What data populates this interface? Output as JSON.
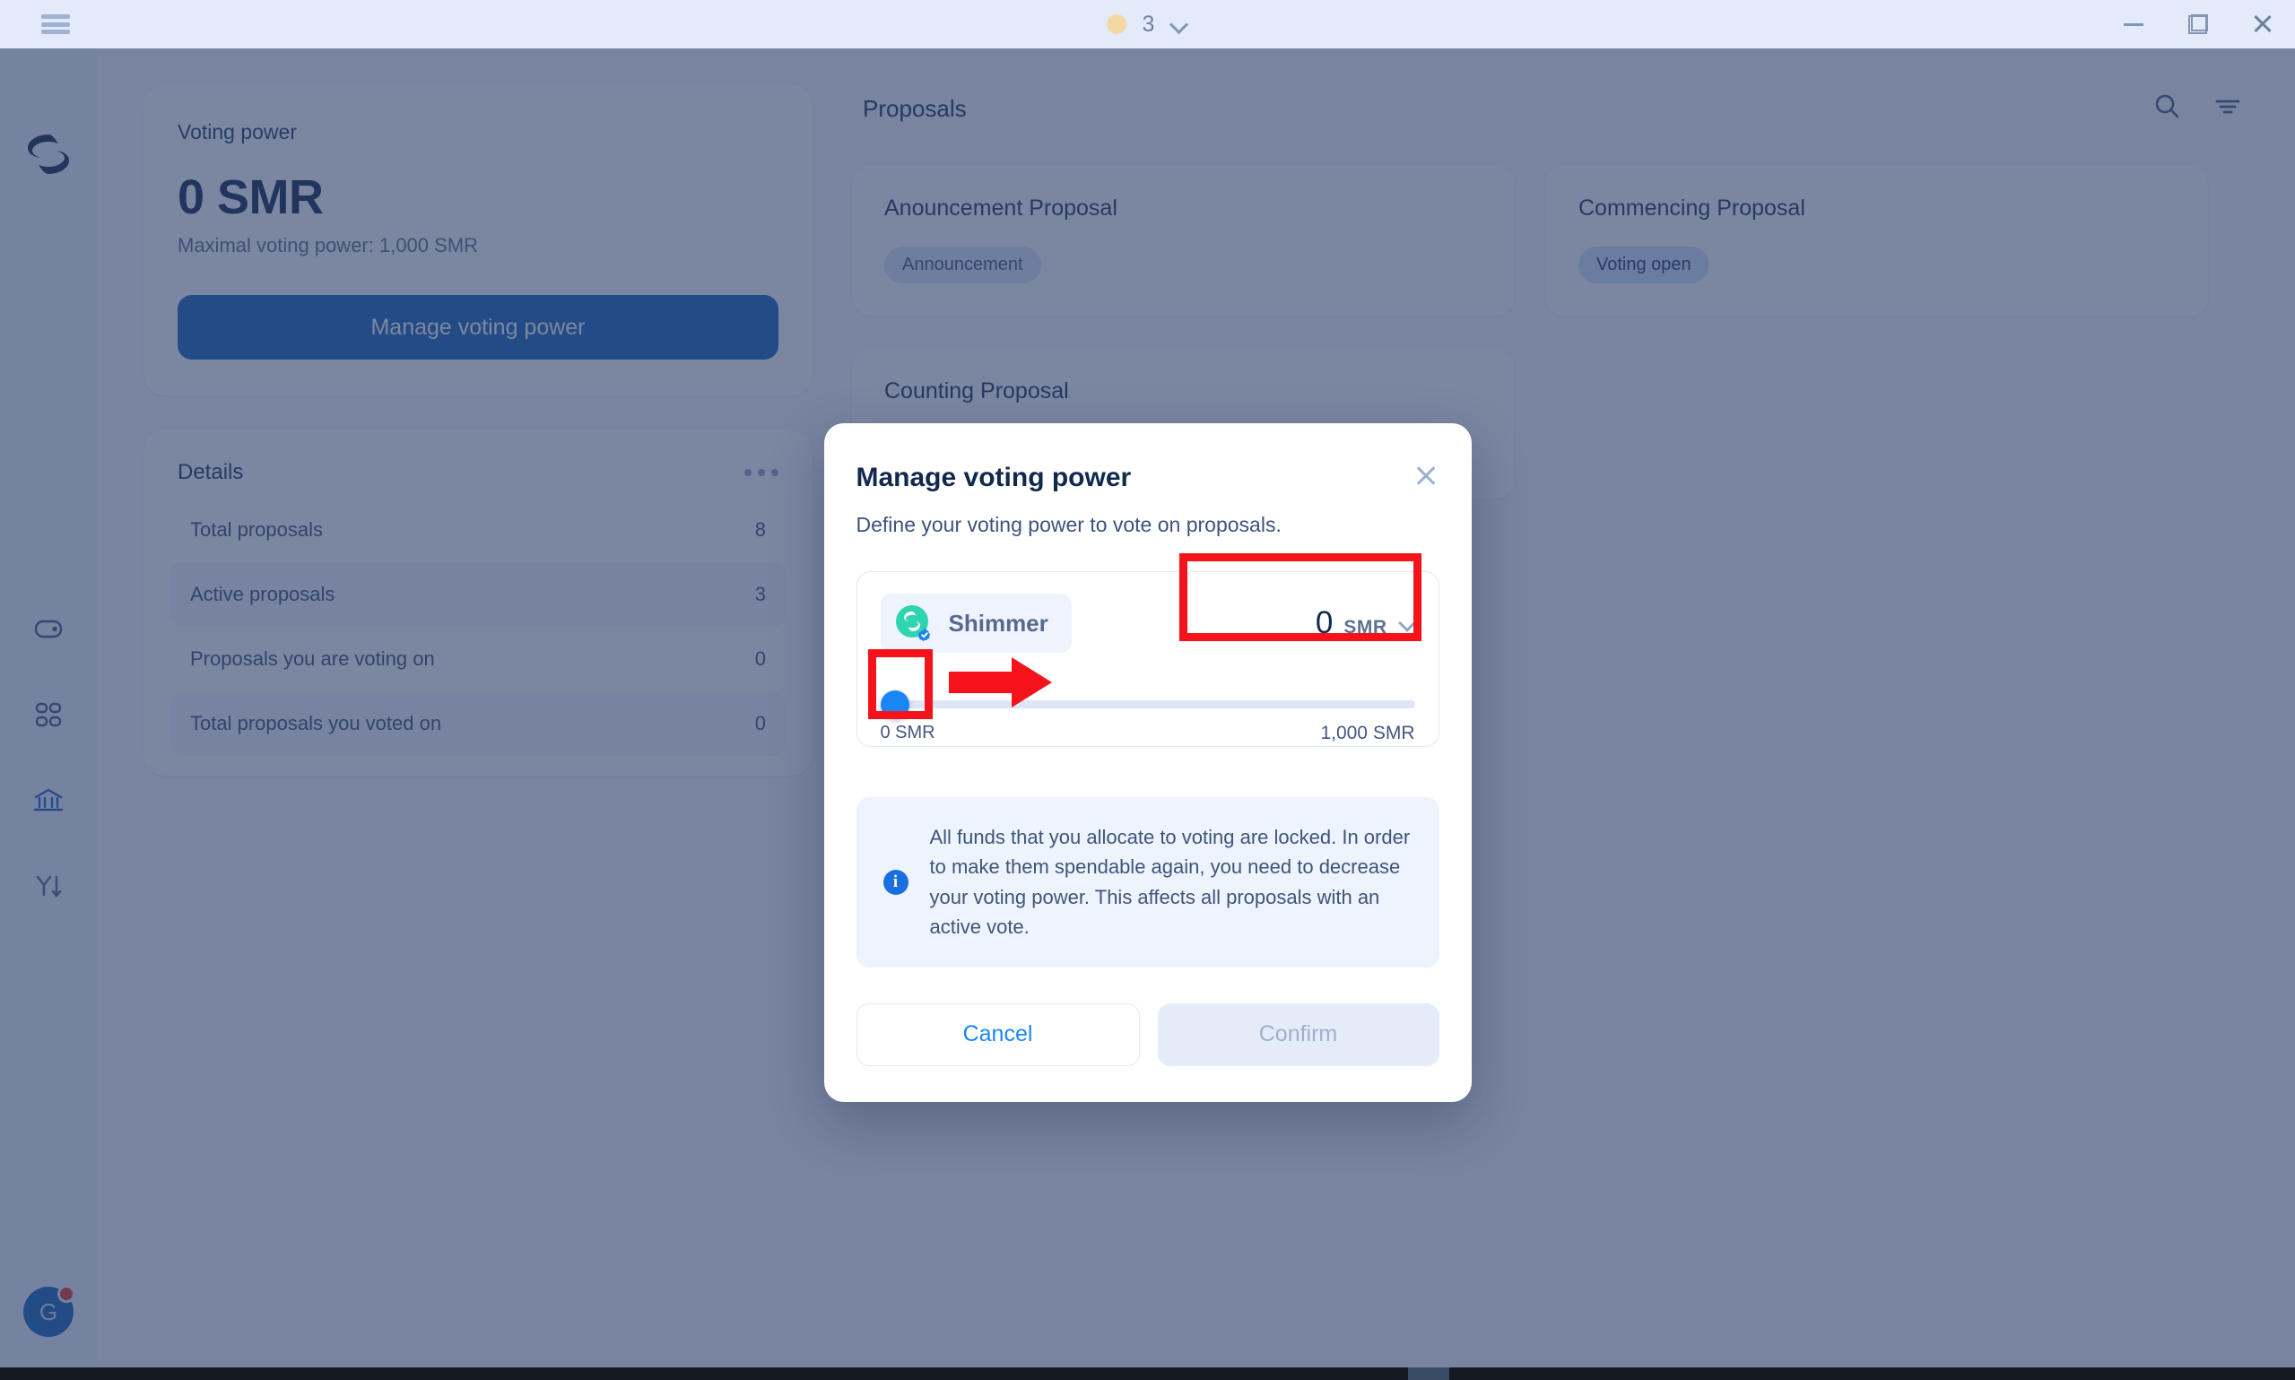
{
  "titlebar": {
    "menu_icon": "hamburger-icon",
    "network_count": "3",
    "network_dot_color": "#f2d9a4",
    "chevron_icon": "chevron-down-icon",
    "minimize_icon": "minimize-icon",
    "maximize_icon": "restore-window-icon",
    "close_icon": "close-icon"
  },
  "sidebar": {
    "logo": "shimmer-logo",
    "items": [
      {
        "name": "wallet",
        "icon": "wallet-icon",
        "active": false
      },
      {
        "name": "apps",
        "icon": "grid-apps-icon",
        "active": false
      },
      {
        "name": "governance",
        "icon": "bank-governance-icon",
        "active": true
      },
      {
        "name": "developer",
        "icon": "tools-icon",
        "active": false
      }
    ],
    "avatar_initial": "G",
    "avatar_color": "#1765b9",
    "notification_dot_color": "#e0392e"
  },
  "voting_power_card": {
    "label": "Voting power",
    "amount": "0 SMR",
    "maximal": "Maximal voting power: 1,000 SMR",
    "manage_button": "Manage voting power"
  },
  "details_card": {
    "title": "Details",
    "more_icon": "ellipsis-icon",
    "rows": [
      {
        "label": "Total proposals",
        "value": "8"
      },
      {
        "label": "Active proposals",
        "value": "3"
      },
      {
        "label": "Proposals you are voting on",
        "value": "0"
      },
      {
        "label": "Total proposals you voted on",
        "value": "0"
      }
    ]
  },
  "proposals": {
    "title": "Proposals",
    "search_icon": "search-icon",
    "filter_icon": "filter-icon",
    "cards": [
      {
        "name": "Anouncement Proposal",
        "status": "Announcement",
        "status_style": "pill-announcement"
      },
      {
        "name": "Commencing Proposal",
        "status": "Voting open",
        "status_style": "pill-voting"
      },
      {
        "name": "Counting Proposal",
        "status": "",
        "status_style": ""
      }
    ]
  },
  "modal": {
    "title": "Manage voting power",
    "close_icon": "close-icon",
    "subtitle": "Define your voting power to vote on proposals.",
    "token": {
      "name": "Shimmer",
      "logo_icon": "shimmer-token-icon",
      "verified_icon": "verified-badge-icon",
      "logo_color": "#2fd4b0",
      "verified_color": "#1a86f5"
    },
    "amount": {
      "value": "0",
      "unit": "SMR",
      "chevron_icon": "chevron-down-icon"
    },
    "slider": {
      "min_label": "0 SMR",
      "max_label": "1,000 SMR",
      "value_percent": 0,
      "thumb_color": "#1a86f5",
      "track_color": "#dde6f7"
    },
    "info": {
      "icon": "info-icon",
      "text": "All funds that you allocate to voting are locked. In order to make them spendable again, you need to decrease your voting power. This affects all proposals with an active vote."
    },
    "cancel_label": "Cancel",
    "confirm_label": "Confirm"
  },
  "annotations": {
    "highlight_color": "#f5131b",
    "boxes": [
      {
        "name": "amount-input-highlight"
      },
      {
        "name": "slider-thumb-highlight"
      }
    ],
    "arrow": {
      "name": "drag-right-arrow",
      "direction": "right"
    }
  }
}
